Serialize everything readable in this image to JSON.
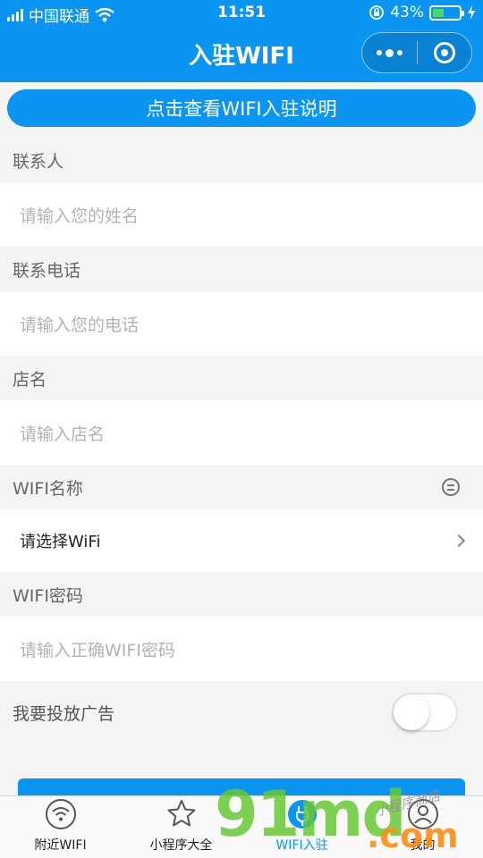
{
  "status_bar": {
    "carrier": "中国联通",
    "time": "11:51",
    "battery_percent": "43%",
    "battery_level": 0.43
  },
  "nav": {
    "title": "入驻WIFI"
  },
  "info_button": "点击查看WIFI入驻说明",
  "form": {
    "contact": {
      "label": "联系人",
      "placeholder": "请输入您的姓名"
    },
    "phone": {
      "label": "联系电话",
      "placeholder": "请输入您的电话"
    },
    "shop": {
      "label": "店名",
      "placeholder": "请输入店名"
    },
    "wifi_name": {
      "label": "WIFI名称",
      "value": "请选择WiFi"
    },
    "wifi_password": {
      "label": "WIFI密码",
      "placeholder": "请输入正确WIFI密码"
    },
    "ad": {
      "label": "我要投放广告",
      "enabled": false
    }
  },
  "tabs": [
    {
      "label": "附近WIFI",
      "icon": "wifi-icon"
    },
    {
      "label": "小程序大全",
      "icon": "star-icon"
    },
    {
      "label": "WIFI入驻",
      "icon": "plug-icon",
      "active": true
    },
    {
      "label": "我的",
      "icon": "user-icon"
    }
  ],
  "watermark": {
    "main": "91md",
    "suffix": ".com",
    "small": "小程序商店"
  },
  "colors": {
    "primary": "#0b95f2",
    "background": "#f4f4f4"
  }
}
